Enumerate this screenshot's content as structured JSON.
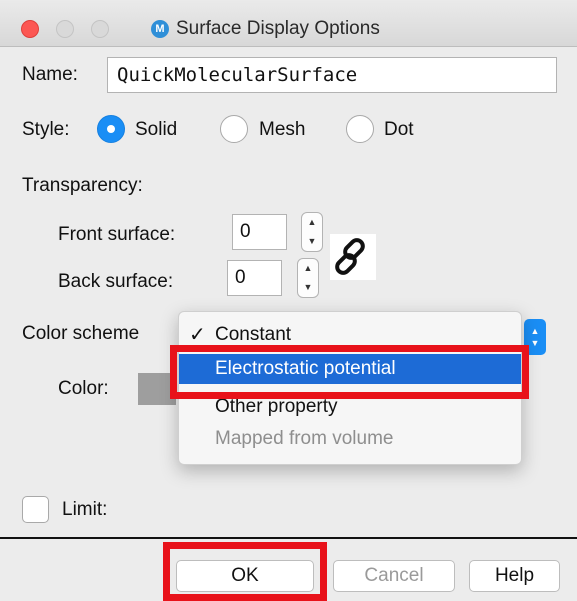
{
  "window": {
    "title": "Surface Display Options",
    "app_icon_letter": "M"
  },
  "name": {
    "label": "Name:",
    "value": "QuickMolecularSurface"
  },
  "style": {
    "label": "Style:",
    "options": [
      {
        "label": "Solid",
        "selected": true
      },
      {
        "label": "Mesh",
        "selected": false
      },
      {
        "label": "Dot",
        "selected": false
      }
    ]
  },
  "transparency": {
    "label": "Transparency:",
    "front_label": "Front surface:",
    "front_value": "0",
    "back_label": "Back surface:",
    "back_value": "0",
    "link_icon": "chain-link-icon"
  },
  "color_scheme": {
    "label": "Color scheme",
    "color_label": "Color:",
    "swatch_color": "#9e9e9e",
    "menu_items": [
      {
        "label": "Constant",
        "checked": true,
        "state": "normal"
      },
      {
        "label": "Electrostatic potential",
        "checked": false,
        "state": "highlighted"
      },
      {
        "label": "Other property",
        "checked": false,
        "state": "normal"
      },
      {
        "label": "Mapped from volume",
        "checked": false,
        "state": "disabled"
      }
    ],
    "check_mark": "✓"
  },
  "limit": {
    "label": "Limit:",
    "checked": false
  },
  "buttons": {
    "ok": "OK",
    "cancel": "Cancel",
    "help": "Help"
  },
  "colors": {
    "accent": "#1a8ef5",
    "menu_highlight": "#1d6bd6",
    "annotation_red": "#e8121a"
  }
}
